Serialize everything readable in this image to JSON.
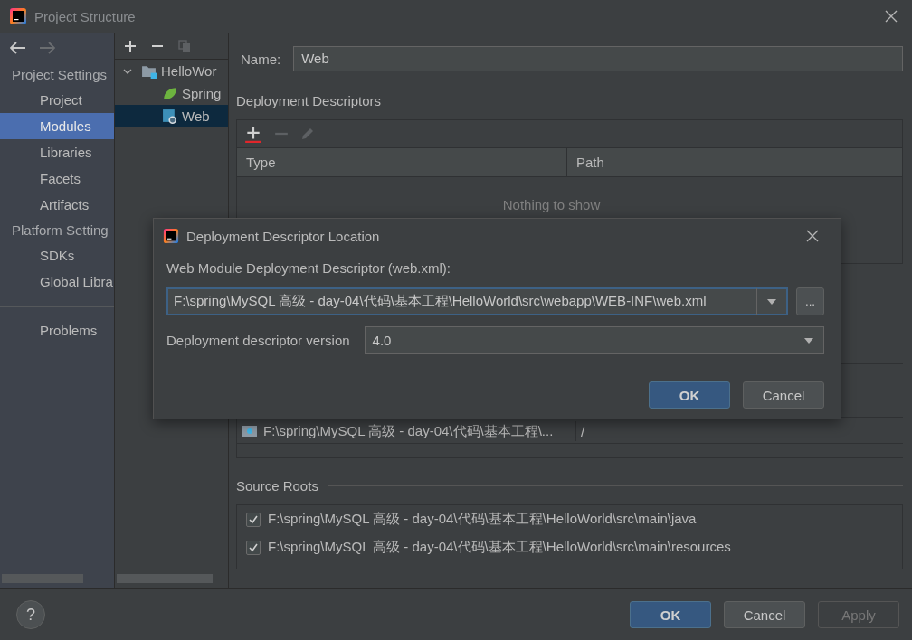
{
  "window": {
    "title": "Project Structure"
  },
  "sidebar": {
    "groups": [
      {
        "heading": "Project Settings",
        "items": [
          {
            "label": "Project",
            "selected": false
          },
          {
            "label": "Modules",
            "selected": true
          },
          {
            "label": "Libraries",
            "selected": false
          },
          {
            "label": "Facets",
            "selected": false
          },
          {
            "label": "Artifacts",
            "selected": false
          }
        ]
      },
      {
        "heading": "Platform Setting",
        "items": [
          {
            "label": "SDKs",
            "selected": false
          },
          {
            "label": "Global Libra",
            "selected": false
          }
        ]
      }
    ],
    "bottom_items": [
      {
        "label": "Problems",
        "selected": false
      }
    ]
  },
  "tree": {
    "items": [
      {
        "label": "HelloWor",
        "kind": "module",
        "expanded": true,
        "selected": false,
        "children": [
          {
            "label": "Spring",
            "kind": "spring",
            "selected": false
          },
          {
            "label": "Web",
            "kind": "web",
            "selected": true
          }
        ]
      }
    ]
  },
  "name_field": {
    "label": "Name:",
    "value": "Web"
  },
  "deployment_descriptors": {
    "title": "Deployment Descriptors",
    "columns": [
      "Type",
      "Path"
    ],
    "empty_text": "Nothing to show"
  },
  "web_resources": {
    "rows": [
      {
        "path": "F:\\spring\\MySQL 高级 - day-04\\代码\\基本工程\\...",
        "relative": "/"
      }
    ]
  },
  "source_roots": {
    "title": "Source Roots",
    "items": [
      {
        "path": "F:\\spring\\MySQL 高级 - day-04\\代码\\基本工程\\HelloWorld\\src\\main\\java",
        "checked": true
      },
      {
        "path": "F:\\spring\\MySQL 高级 - day-04\\代码\\基本工程\\HelloWorld\\src\\main\\resources",
        "checked": true
      }
    ]
  },
  "footer": {
    "help": "?",
    "buttons": [
      {
        "label": "OK",
        "kind": "primary",
        "disabled": false
      },
      {
        "label": "Cancel",
        "kind": "normal",
        "disabled": false
      },
      {
        "label": "Apply",
        "kind": "normal",
        "disabled": true
      }
    ]
  },
  "dialog": {
    "title": "Deployment Descriptor Location",
    "field_label": "Web Module Deployment Descriptor (web.xml):",
    "path": "F:\\spring\\MySQL 高级 - day-04\\代码\\基本工程\\HelloWorld\\src\\webapp\\WEB-INF\\web.xml",
    "browse": "...",
    "version_label": "Deployment descriptor version",
    "version": "4.0",
    "buttons": [
      {
        "label": "OK",
        "kind": "primary",
        "disabled": false
      },
      {
        "label": "Cancel",
        "kind": "normal",
        "disabled": false
      }
    ]
  }
}
